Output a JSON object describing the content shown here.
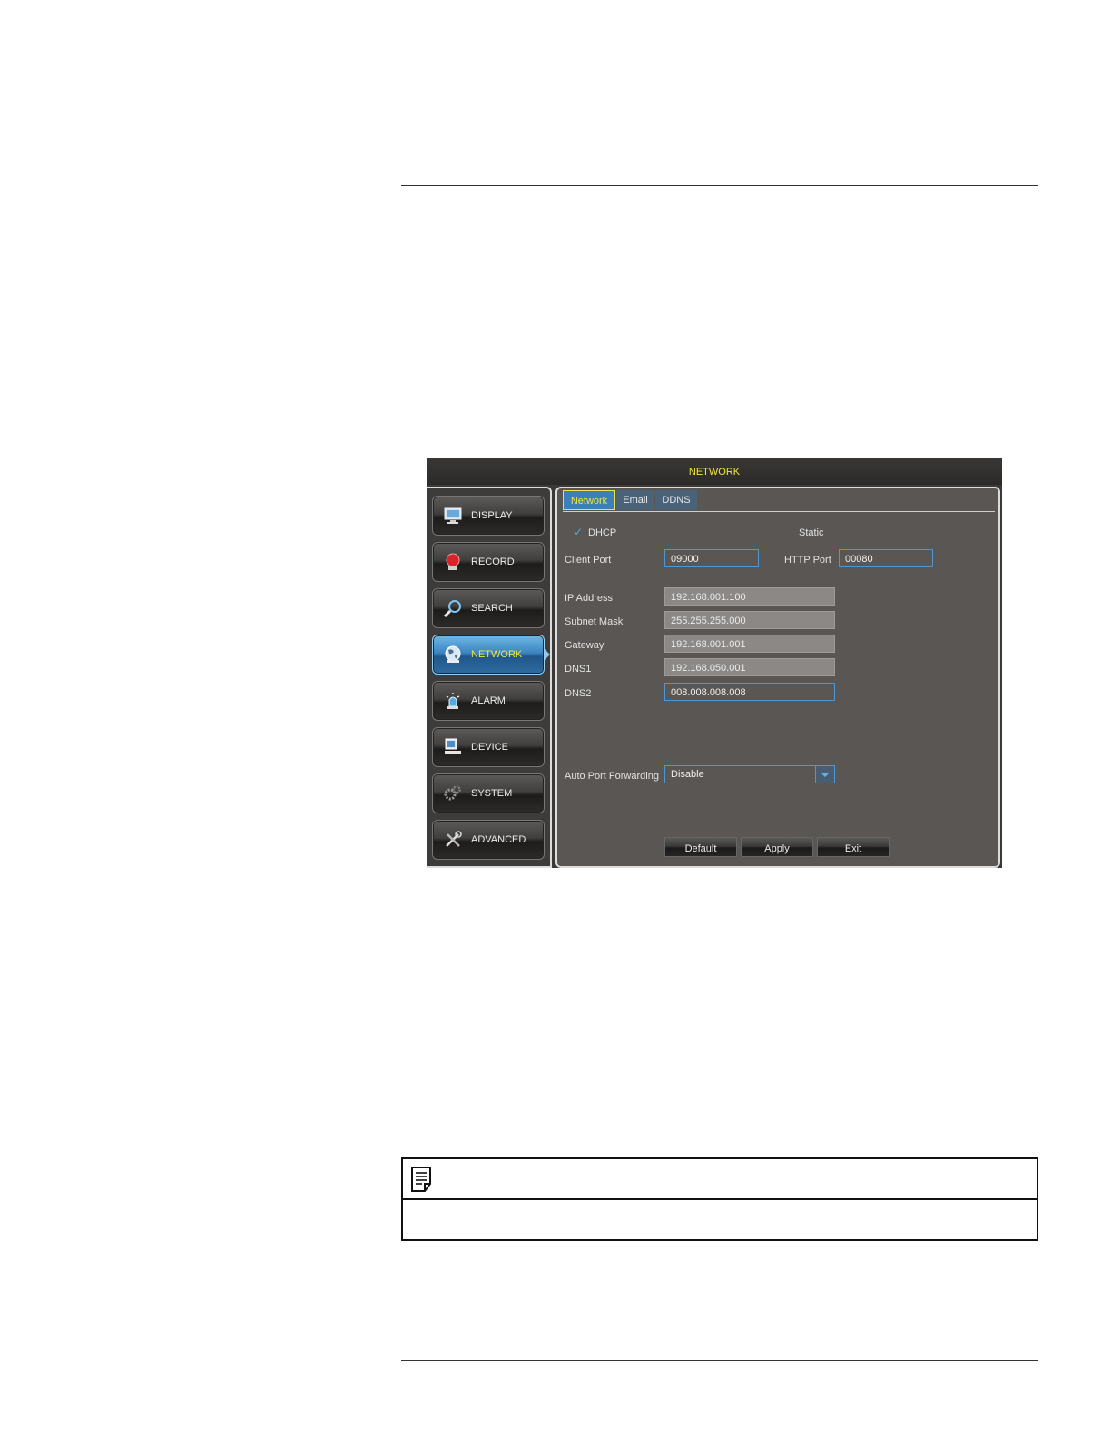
{
  "window": {
    "title": "NETWORK"
  },
  "sidebar": {
    "items": [
      {
        "label": "DISPLAY",
        "icon": "monitor-icon"
      },
      {
        "label": "RECORD",
        "icon": "record-icon"
      },
      {
        "label": "SEARCH",
        "icon": "magnifier-icon"
      },
      {
        "label": "NETWORK",
        "icon": "globe-icon",
        "active": true
      },
      {
        "label": "ALARM",
        "icon": "alarm-siren-icon"
      },
      {
        "label": "DEVICE",
        "icon": "computer-icon"
      },
      {
        "label": "SYSTEM",
        "icon": "gears-icon"
      },
      {
        "label": "ADVANCED",
        "icon": "tools-icon"
      }
    ]
  },
  "tabs": [
    {
      "label": "Network",
      "active": true
    },
    {
      "label": "Email"
    },
    {
      "label": "DDNS"
    }
  ],
  "form": {
    "mode_dhcp": "DHCP",
    "mode_static": "Static",
    "client_port": {
      "label": "Client Port",
      "value": "09000"
    },
    "http_port": {
      "label": "HTTP Port",
      "value": "00080"
    },
    "ip_address": {
      "label": "IP Address",
      "value": "192.168.001.100"
    },
    "subnet_mask": {
      "label": "Subnet Mask",
      "value": "255.255.255.000"
    },
    "gateway": {
      "label": "Gateway",
      "value": "192.168.001.001"
    },
    "dns1": {
      "label": "DNS1",
      "value": "192.168.050.001"
    },
    "dns2": {
      "label": "DNS2",
      "value": "008.008.008.008"
    },
    "auto_port_forwarding": {
      "label": "Auto Port Forwarding",
      "value": "Disable"
    }
  },
  "buttons": {
    "default": "Default",
    "apply": "Apply",
    "exit": "Exit"
  },
  "colors": {
    "accent_yellow": "#f2e63a",
    "active_blue": "#3d85c0",
    "panel_gray": "#5a5653"
  },
  "note": {
    "icon": "note-icon"
  }
}
